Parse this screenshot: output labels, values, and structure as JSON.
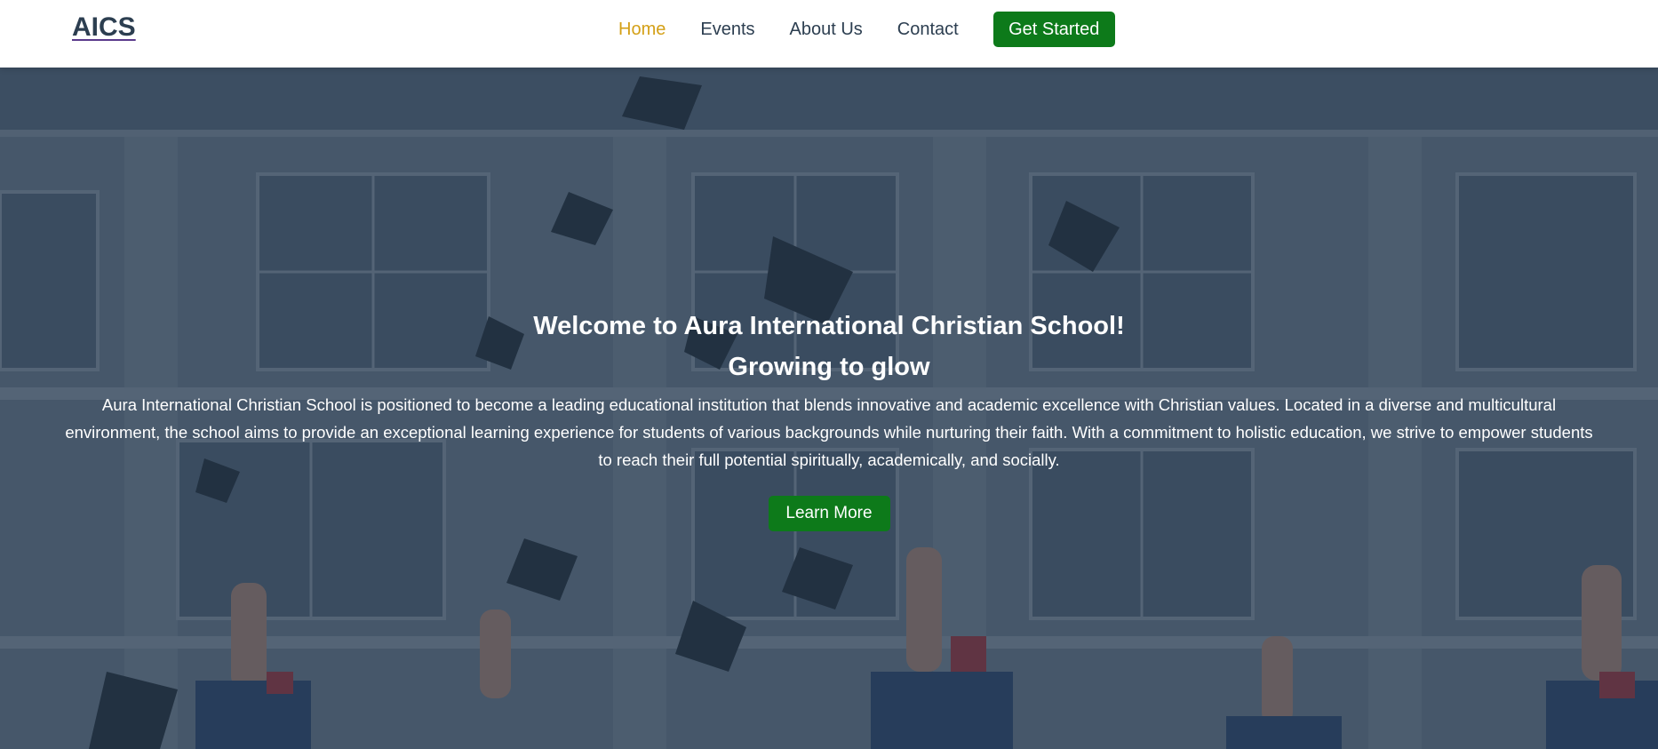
{
  "nav": {
    "logo": "AICS",
    "links": [
      {
        "label": "Home",
        "active": true
      },
      {
        "label": "Events",
        "active": false
      },
      {
        "label": "About Us",
        "active": false
      },
      {
        "label": "Contact",
        "active": false
      }
    ],
    "cta_label": "Get Started"
  },
  "hero": {
    "title": "Welcome to Aura International Christian School!",
    "subtitle": "Growing to glow",
    "text": "Aura International Christian School is positioned to become a leading educational institution that blends innovative and academic excellence with Christian values. Located in a diverse and multicultural environment, the school aims to provide an exceptional learning experience for students of various backgrounds while nurturing their faith. With a commitment to holistic education, we strive to empower students to reach their full potential spiritually, academically, and socially.",
    "button_label": "Learn More",
    "background_image": "graduation-caps-building-photo"
  },
  "colors": {
    "accent_green": "#0d7a1a",
    "active_link": "#d4a017",
    "nav_text": "#2c3e50",
    "overlay": "#24364a"
  }
}
